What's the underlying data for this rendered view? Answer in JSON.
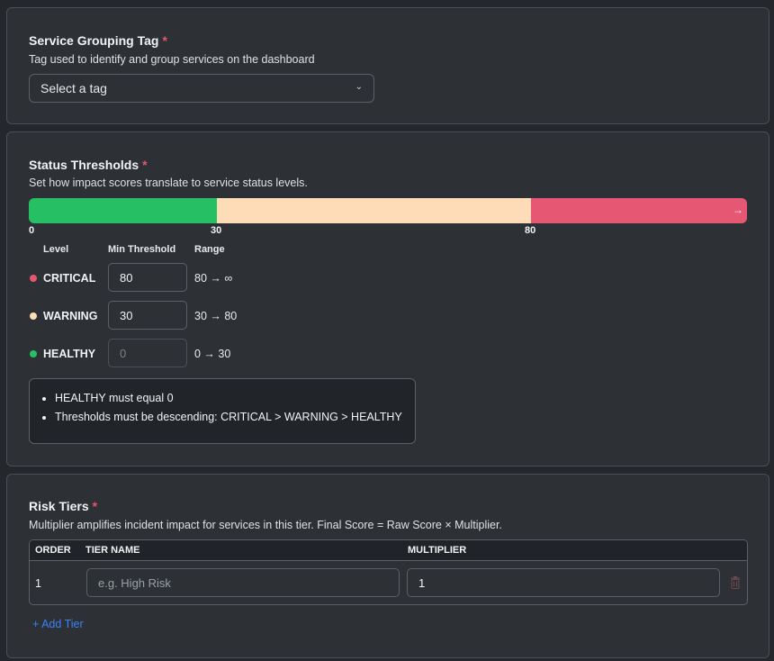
{
  "grouping": {
    "title": "Service Grouping Tag",
    "required_mark": "*",
    "description": "Tag used to identify and group services on the dashboard",
    "select_value": "Select a tag",
    "chevron": "⌄"
  },
  "thresholds": {
    "title": "Status Thresholds",
    "required_mark": "*",
    "description": "Set how impact scores translate to service status levels.",
    "bar": {
      "ticks": [
        "0",
        "30",
        "80"
      ],
      "arrow": "→",
      "colors": {
        "healthy": "#26bf64",
        "warning": "#ffdcb8",
        "critical": "#e55773"
      }
    },
    "columns": {
      "level": "Level",
      "min": "Min Threshold",
      "range": "Range"
    },
    "rows": [
      {
        "level": "CRITICAL",
        "min": "80",
        "range": "80 → ∞",
        "color": "#e55773"
      },
      {
        "level": "WARNING",
        "min": "30",
        "range": "30 → 80",
        "color": "#ffdcb8"
      },
      {
        "level": "HEALTHY",
        "min": "0",
        "range": "0 → 30",
        "color": "#26bf64"
      }
    ],
    "errors": [
      "HEALTHY must equal 0",
      "Thresholds must be descending: CRITICAL > WARNING > HEALTHY"
    ]
  },
  "risk": {
    "title": "Risk Tiers",
    "required_mark": "*",
    "description": "Multiplier amplifies incident impact for services in this tier. Final Score = Raw Score × Multiplier.",
    "columns": {
      "order": "ORDER",
      "name": "TIER NAME",
      "multiplier": "MULTIPLIER"
    },
    "rows": [
      {
        "order": "1",
        "name_placeholder": "e.g. High Risk",
        "multiplier": "1"
      }
    ],
    "add_label": "+ Add Tier"
  }
}
